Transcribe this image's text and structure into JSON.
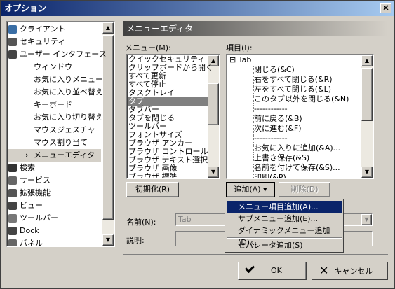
{
  "window": {
    "title": "オプション",
    "close_label": "×"
  },
  "tree": {
    "items": [
      {
        "label": "クライアント",
        "icon": "client-icon",
        "indent": 0
      },
      {
        "label": "セキュリティ",
        "icon": "shield-icon",
        "indent": 0
      },
      {
        "label": "ユーザー インタフェース",
        "icon": "user-icon",
        "indent": 0
      },
      {
        "label": "ウィンドウ",
        "icon": "",
        "indent": 1
      },
      {
        "label": "お気に入りメニュー",
        "icon": "",
        "indent": 1
      },
      {
        "label": "お気に入り並べ替え",
        "icon": "",
        "indent": 1
      },
      {
        "label": "キーボード",
        "icon": "",
        "indent": 1
      },
      {
        "label": "お気に入り切り替え",
        "icon": "",
        "indent": 1
      },
      {
        "label": "マウスジェスチャ",
        "icon": "",
        "indent": 1
      },
      {
        "label": "マウス割り当て",
        "icon": "",
        "indent": 1
      },
      {
        "label": "メニューエディタ",
        "icon": "arrow-icon",
        "indent": 1,
        "selected": true
      },
      {
        "label": "検索",
        "icon": "search-icon",
        "indent": 0
      },
      {
        "label": "サービス",
        "icon": "service-icon",
        "indent": 0
      },
      {
        "label": "拡張機能",
        "icon": "extension-icon",
        "indent": 0
      },
      {
        "label": "ビュー",
        "icon": "view-icon",
        "indent": 0
      },
      {
        "label": "ツールバー",
        "icon": "toolbar-icon",
        "indent": 0
      },
      {
        "label": "Dock",
        "icon": "folder-icon",
        "indent": 0
      },
      {
        "label": "パネル",
        "icon": "panel-icon",
        "indent": 0
      }
    ]
  },
  "panel": {
    "title": "メニューエディタ"
  },
  "menu_list": {
    "label": "メニュー(M):",
    "items": [
      "クイックセキュリティ",
      "クリップボードから開く",
      "すべて更新",
      "すべて停止",
      "タスクトレイ",
      "タブ",
      "タブバー",
      "タブを閉じる",
      "ツールバー",
      "フォントサイズ",
      "ブラウザ アンカー",
      "ブラウザ コントロール",
      "ブラウザ テキスト選択",
      "ブラウザ 画像",
      "ブラウザ 標準"
    ],
    "selected_index": 5
  },
  "items_tree": {
    "label": "項目(I):",
    "root": "Tab",
    "items": [
      "閉じる(&C)",
      "右をすべて閉じる(&R)",
      "左をすべて閉じる(&L)",
      "このタブ以外を閉じる(&N)",
      "------------",
      "前に戻る(&B)",
      "次に進む(&F)",
      "------------",
      "お気に入りに追加(&A)...",
      "上書き保存(&S)",
      "名前を付けて保存(&S)...",
      "印刷(&P)"
    ]
  },
  "buttons": {
    "init": "初期化(R)",
    "add": "追加(A)",
    "delete": "削除(D)",
    "ok": "OK",
    "cancel": "キャンセル"
  },
  "fields": {
    "name_label": "名前(N):",
    "name_value": "Tab",
    "desc_label": "説明:"
  },
  "dropdown_menu": {
    "items": [
      "メニュー項目追加(A)...",
      "サブメニュー追加(E)...",
      "ダイナミックメニュー追加(D)...",
      "セパレータ追加(S)"
    ],
    "highlighted_index": 0
  }
}
